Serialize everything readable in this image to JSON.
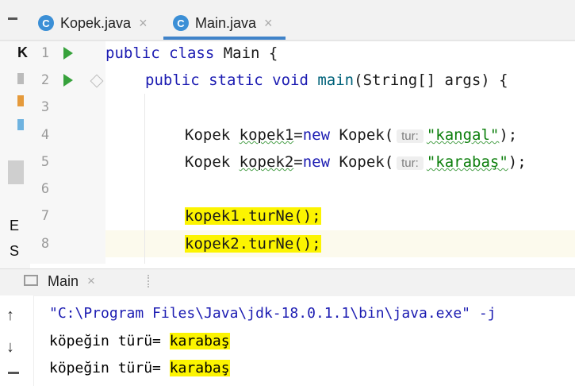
{
  "tabs": [
    {
      "label": "Kopek.java",
      "icon": "C",
      "close": "×"
    },
    {
      "label": "Main.java",
      "icon": "C",
      "close": "×",
      "active": true
    }
  ],
  "gutter": {
    "lines": [
      "1",
      "2",
      "3",
      "4",
      "5",
      "6",
      "7",
      "8"
    ]
  },
  "code": {
    "l1": {
      "kw": "public class",
      "rest": " Main {"
    },
    "l2": {
      "kw1": "public static void",
      "fn": "main",
      "rest": "(String[] args) {"
    },
    "l4": {
      "a": "Kopek ",
      "var": "kopek1",
      "eq": "=",
      "kw": "new",
      "b": " Kopek(",
      "hint": "tur:",
      "str": "\"kangal\"",
      "end": ");"
    },
    "l5": {
      "a": "Kopek ",
      "var": "kopek2",
      "eq": "=",
      "kw": "new",
      "b": " Kopek(",
      "hint": "tur:",
      "str": "\"karabaş\"",
      "end": ");"
    },
    "l7": "kopek1.turNe();",
    "l8": "kopek2.turNe();"
  },
  "left_fragments": {
    "k": "K",
    "e": "E",
    "s": "S"
  },
  "run_panel": {
    "title": "Main",
    "close": "×"
  },
  "console": {
    "line1": "\"C:\\Program Files\\Java\\jdk-18.0.1.1\\bin\\java.exe\" -j",
    "line2_prefix": "köpeğin türü= ",
    "line2_value": "karabaş",
    "line3_prefix": "köpeğin türü= ",
    "line3_value": "karabaş",
    "up_arrow": "↑",
    "down_arrow": "↓"
  },
  "colors": {
    "accent": "#4083c9",
    "run_green": "#37a23c",
    "highlight": "#fcf400",
    "keyword": "#1c1cb2",
    "string": "#0b7e0b"
  }
}
